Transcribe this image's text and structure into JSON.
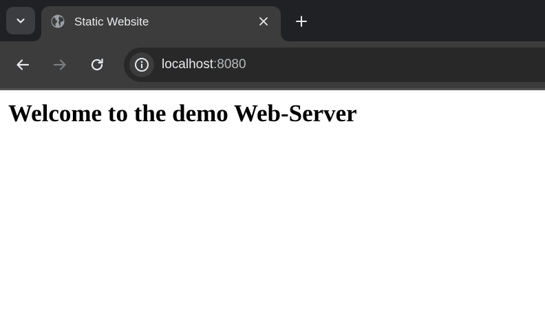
{
  "browser": {
    "tab": {
      "title": "Static Website",
      "favicon": "globe-icon"
    },
    "tab_search_icon": "chevron-down-icon",
    "new_tab_icon": "plus-icon",
    "close_icon": "close-icon",
    "nav": {
      "back_icon": "arrow-left-icon",
      "forward_icon": "arrow-right-icon",
      "reload_icon": "reload-icon"
    },
    "omnibox": {
      "site_info_icon": "info-icon",
      "host": "localhost",
      "port": ":8080"
    },
    "colors": {
      "tabstrip_bg": "#202124",
      "toolbar_bg": "#3c3c3c",
      "omnibox_bg": "#282828",
      "text": "#e8eaed"
    }
  },
  "page": {
    "heading": "Welcome to the demo Web-Server"
  }
}
